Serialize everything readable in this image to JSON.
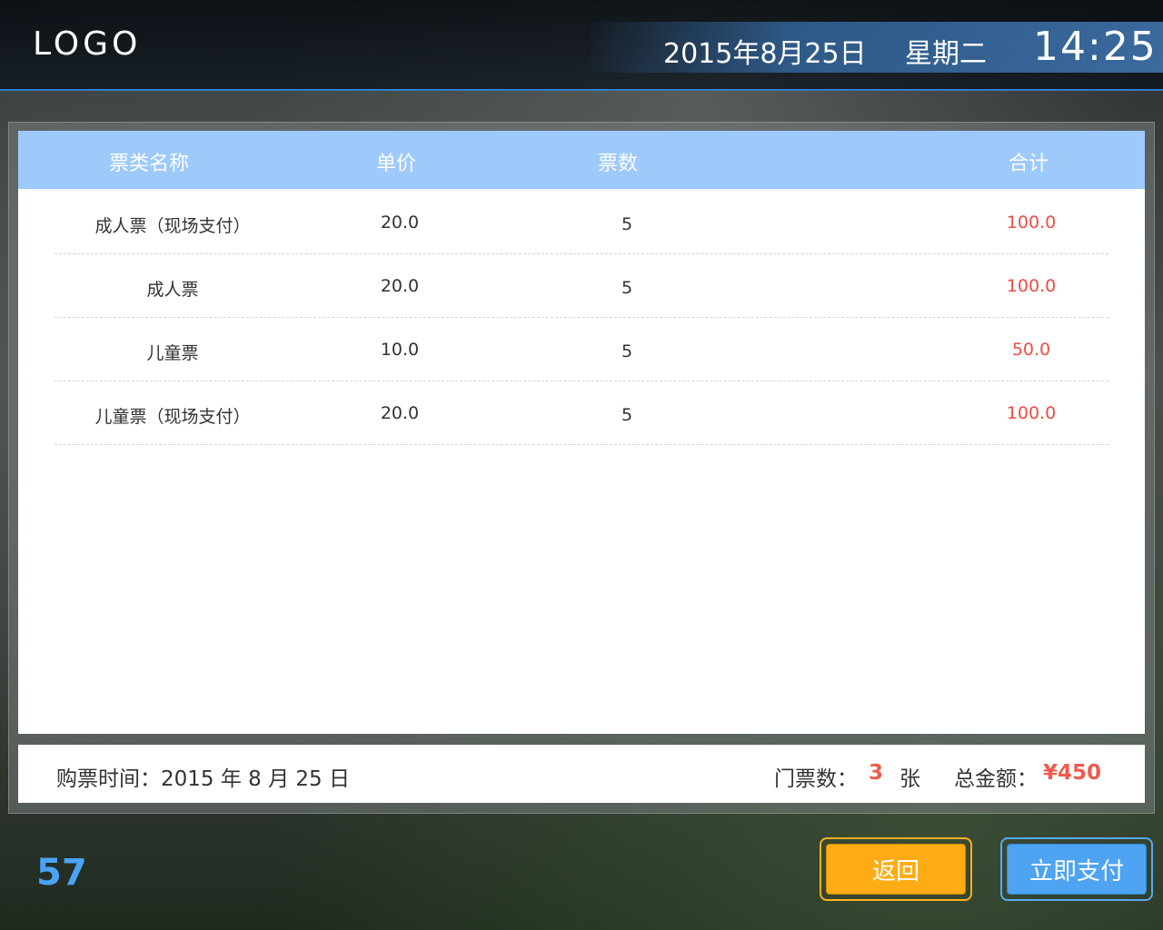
{
  "header": {
    "logo": "LOGO",
    "date": "2015年8月25日",
    "weekday": "星期二",
    "time": "14:25"
  },
  "table": {
    "columns": [
      "票类名称",
      "单价",
      "票数",
      "合计"
    ],
    "rows": [
      {
        "name": "成人票（现场支付）",
        "price": "20.0",
        "qty": "5",
        "total": "100.0"
      },
      {
        "name": "成人票",
        "price": "20.0",
        "qty": "5",
        "total": "100.0"
      },
      {
        "name": "儿童票",
        "price": "10.0",
        "qty": "5",
        "total": "50.0"
      },
      {
        "name": "儿童票（现场支付）",
        "price": "20.0",
        "qty": "5",
        "total": "100.0"
      }
    ]
  },
  "summary": {
    "buy_time": "购票时间：2015 年 8 月 25 日",
    "ticket_count_label": "门票数：",
    "ticket_count": "3",
    "ticket_unit": "张",
    "total_label": "总金额：",
    "total_amount": "¥450"
  },
  "countdown": "57",
  "buttons": {
    "back": "返回",
    "pay": "立即支付"
  },
  "colors": {
    "accent_blue": "#4ea3f2",
    "header_blue": "#9dc9fb",
    "price_red": "#ef4c45",
    "back_orange": "#ffac14"
  }
}
